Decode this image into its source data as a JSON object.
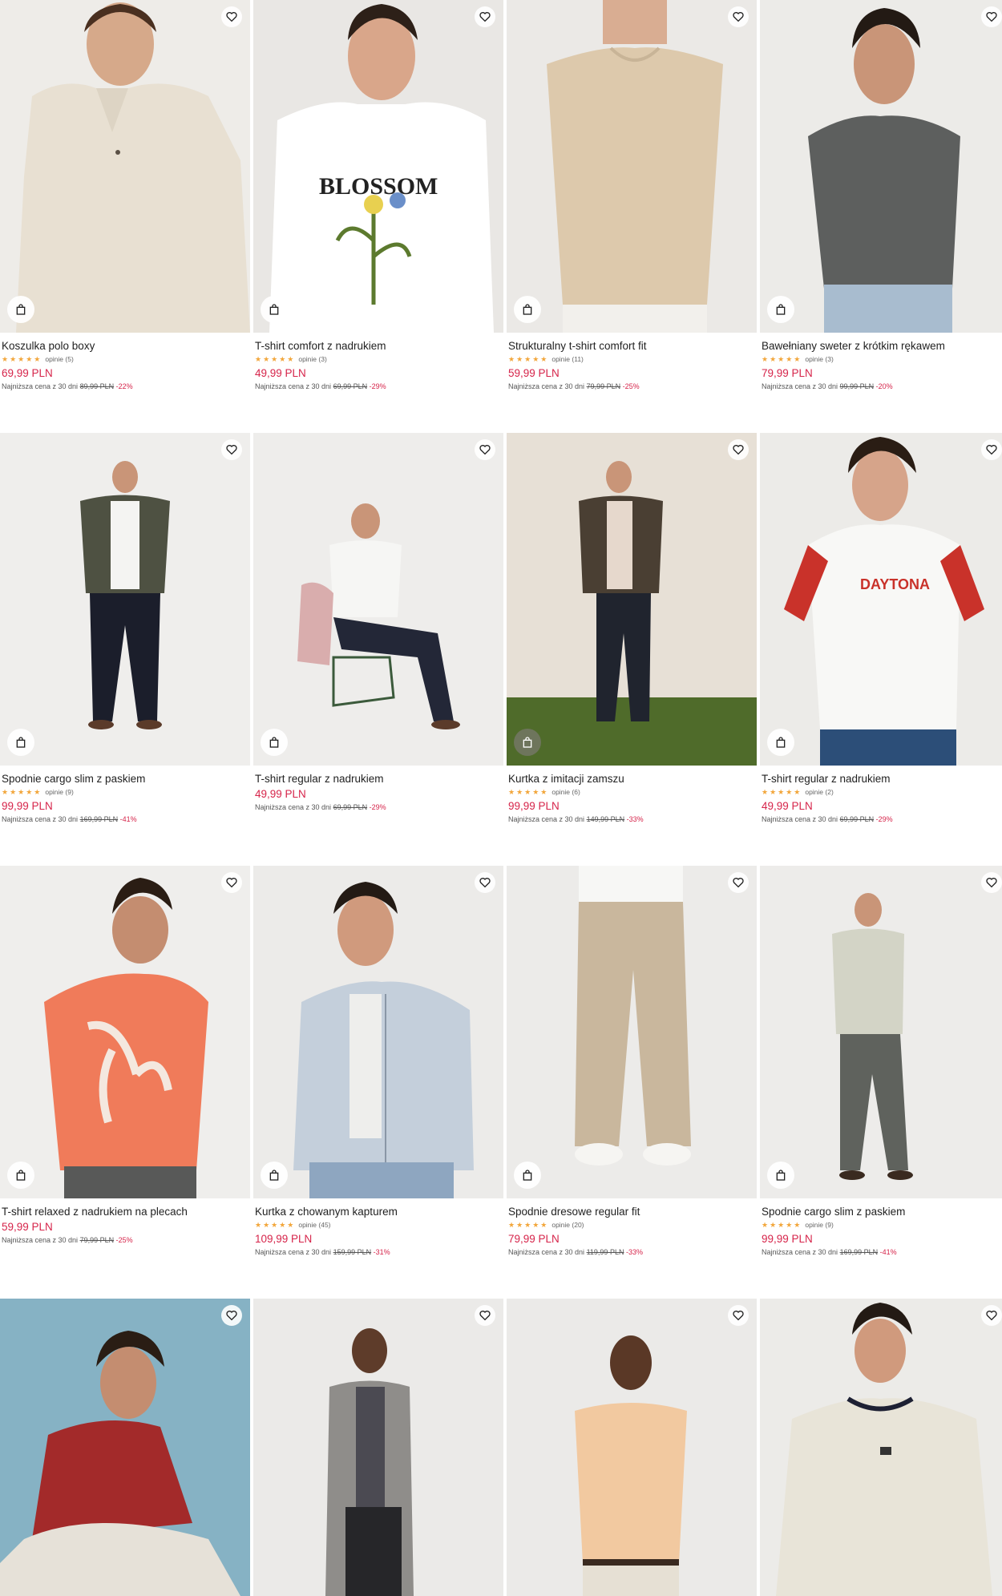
{
  "icons": {
    "favorite": "heart-outline-icon",
    "add_to_bag": "shopping-bag-icon",
    "rating": "star-icon"
  },
  "colors": {
    "price": "#d6244a",
    "star": "#f2a63b"
  },
  "products": [
    {
      "name": "Koszulka polo boxy",
      "stars": "★★★★★",
      "reviews": "opinie (5)",
      "price": "69,99 PLN",
      "lowest_label": "Najniższa cena z 30 dni",
      "old_price": "89,99 PLN",
      "discount": "-22%"
    },
    {
      "name": "T-shirt comfort z nadrukiem",
      "stars": "★★★★★",
      "reviews": "opinie (3)",
      "price": "49,99 PLN",
      "lowest_label": "Najniższa cena z 30 dni",
      "old_price": "69,99 PLN",
      "discount": "-29%"
    },
    {
      "name": "Strukturalny t-shirt comfort fit",
      "stars": "★★★★★",
      "reviews": "opinie (11)",
      "price": "59,99 PLN",
      "lowest_label": "Najniższa cena z 30 dni",
      "old_price": "79,99 PLN",
      "discount": "-25%"
    },
    {
      "name": "Bawełniany sweter z krótkim rękawem",
      "stars": "★★★★★",
      "reviews": "opinie (3)",
      "price": "79,99 PLN",
      "lowest_label": "Najniższa cena z 30 dni",
      "old_price": "99,99 PLN",
      "discount": "-20%"
    },
    {
      "name": "Spodnie cargo slim z paskiem",
      "stars": "★★★★★",
      "reviews": "opinie (9)",
      "price": "99,99 PLN",
      "lowest_label": "Najniższa cena z 30 dni",
      "old_price": "169,99 PLN",
      "discount": "-41%"
    },
    {
      "name": "T-shirt regular z nadrukiem",
      "stars": "",
      "reviews": "",
      "price": "49,99 PLN",
      "lowest_label": "Najniższa cena z 30 dni",
      "old_price": "69,99 PLN",
      "discount": "-29%"
    },
    {
      "name": "Kurtka z imitacji zamszu",
      "stars": "★★★★★",
      "reviews": "opinie (6)",
      "price": "99,99 PLN",
      "lowest_label": "Najniższa cena z 30 dni",
      "old_price": "149,99 PLN",
      "discount": "-33%"
    },
    {
      "name": "T-shirt regular z nadrukiem",
      "stars": "★★★★★",
      "reviews": "opinie (2)",
      "price": "49,99 PLN",
      "lowest_label": "Najniższa cena z 30 dni",
      "old_price": "69,99 PLN",
      "discount": "-29%"
    },
    {
      "name": "T-shirt relaxed z nadrukiem na plecach",
      "stars": "",
      "reviews": "",
      "price": "59,99 PLN",
      "lowest_label": "Najniższa cena z 30 dni",
      "old_price": "79,99 PLN",
      "discount": "-25%"
    },
    {
      "name": "Kurtka z chowanym kapturem",
      "stars": "★★★★★",
      "reviews": "opinie (45)",
      "price": "109,99 PLN",
      "lowest_label": "Najniższa cena z 30 dni",
      "old_price": "159,99 PLN",
      "discount": "-31%"
    },
    {
      "name": "Spodnie dresowe regular fit",
      "stars": "★★★★★",
      "reviews": "opinie (20)",
      "price": "79,99 PLN",
      "lowest_label": "Najniższa cena z 30 dni",
      "old_price": "119,99 PLN",
      "discount": "-33%"
    },
    {
      "name": "Spodnie cargo slim z paskiem",
      "stars": "★★★★★",
      "reviews": "opinie (9)",
      "price": "99,99 PLN",
      "lowest_label": "Najniższa cena z 30 dni",
      "old_price": "169,99 PLN",
      "discount": "-41%"
    },
    {
      "name": "",
      "stars": "",
      "reviews": "",
      "price": "",
      "lowest_label": "",
      "old_price": "",
      "discount": ""
    },
    {
      "name": "",
      "stars": "",
      "reviews": "",
      "price": "",
      "lowest_label": "",
      "old_price": "",
      "discount": ""
    },
    {
      "name": "",
      "stars": "",
      "reviews": "",
      "price": "",
      "lowest_label": "",
      "old_price": "",
      "discount": ""
    },
    {
      "name": "",
      "stars": "",
      "reviews": "",
      "price": "",
      "lowest_label": "",
      "old_price": "",
      "discount": ""
    }
  ]
}
